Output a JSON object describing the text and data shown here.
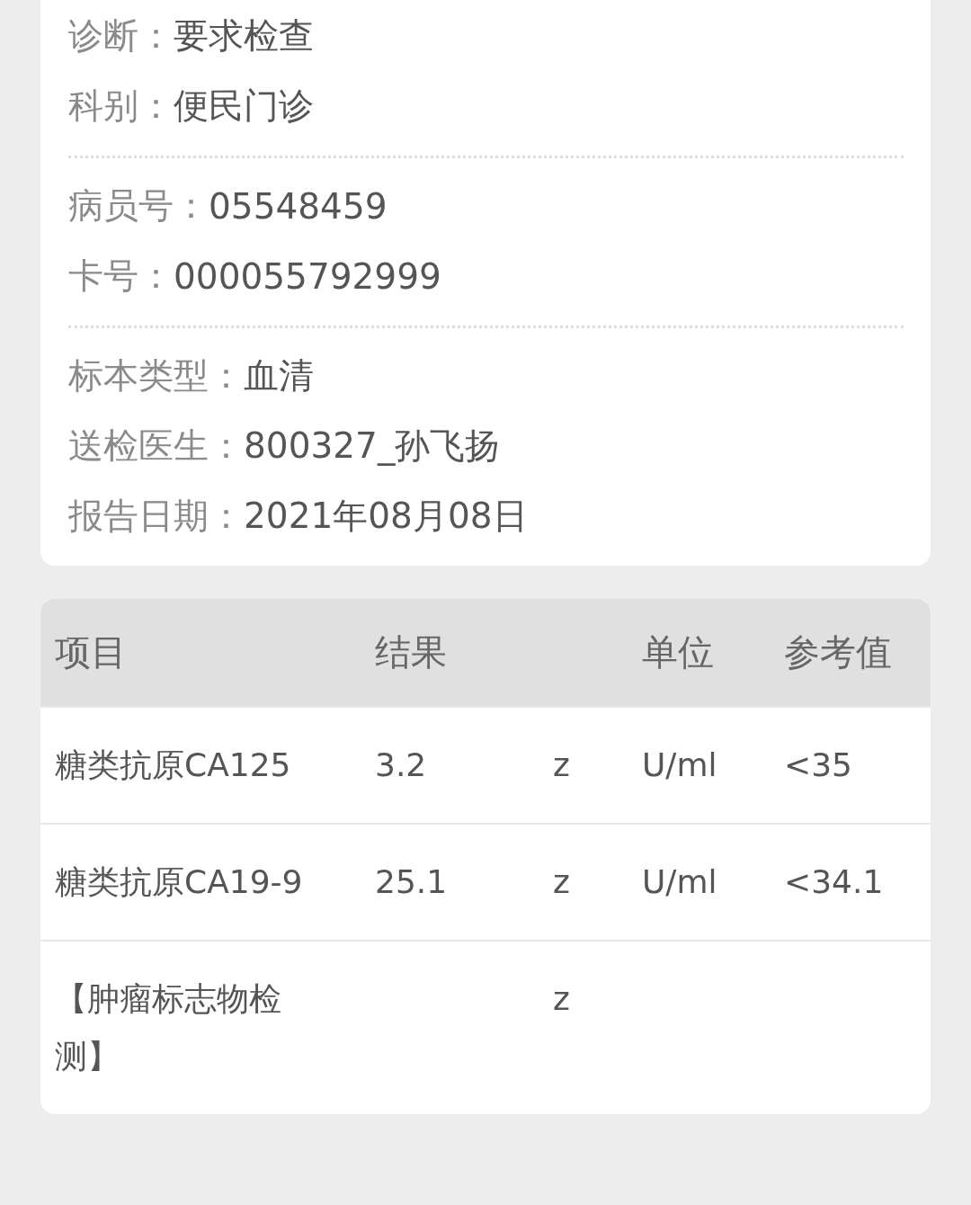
{
  "info_sections": [
    {
      "fields": [
        {
          "label": "诊断：",
          "value": "要求检查"
        },
        {
          "label": "科别：",
          "value": "便民门诊"
        }
      ]
    },
    {
      "fields": [
        {
          "label": "病员号：",
          "value": "05548459"
        },
        {
          "label": "卡号：",
          "value": "000055792999"
        }
      ]
    },
    {
      "fields": [
        {
          "label": "标本类型：",
          "value": "血清"
        },
        {
          "label": "送检医生：",
          "value": "800327_孙飞扬"
        },
        {
          "label": "报告日期：",
          "value": "2021年08月08日"
        }
      ]
    }
  ],
  "table": {
    "columns": [
      "项目",
      "结果",
      null,
      "单位",
      "参考值"
    ],
    "rows": [
      {
        "cells": [
          "糖类抗原CA125",
          "3.2",
          "z",
          "U/ml",
          "<35"
        ]
      },
      {
        "cells": [
          "糖类抗原CA19-9",
          "25.1",
          "z",
          "U/ml",
          "<34.1"
        ]
      },
      {
        "cells": [
          "【肿瘤标志物检测】",
          null,
          "z",
          null,
          null
        ]
      }
    ]
  }
}
